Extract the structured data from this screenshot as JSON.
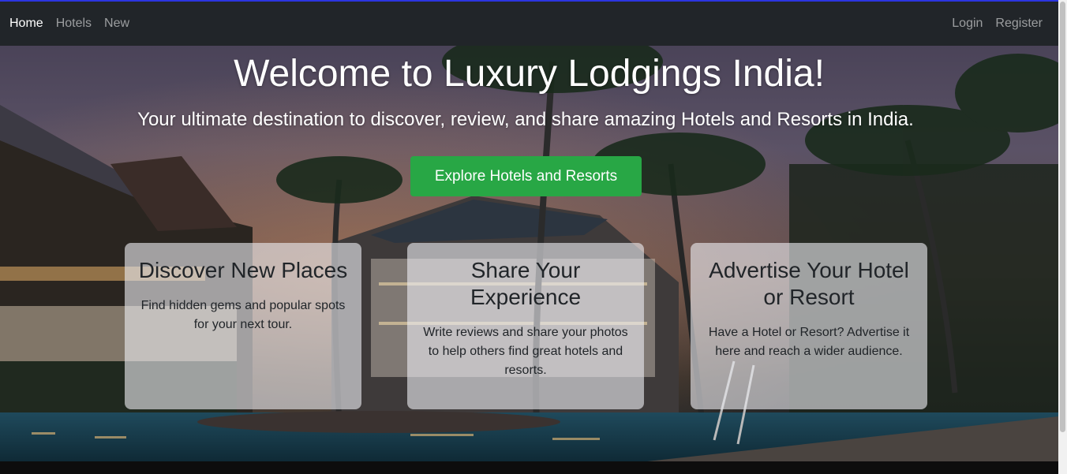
{
  "nav": {
    "left": [
      "Home",
      "Hotels",
      "New"
    ],
    "right": [
      "Login",
      "Register"
    ],
    "active": "Home"
  },
  "hero": {
    "title": "Welcome to Luxury Lodgings India!",
    "subtitle": "Your ultimate destination to discover, review, and share amazing Hotels and Resorts in India.",
    "cta_label": "Explore Hotels and Resorts"
  },
  "cards": [
    {
      "title": "Discover New Places",
      "text": "Find hidden gems and popular spots for your next tour."
    },
    {
      "title": "Share Your Experience",
      "text": "Write reviews and share your photos to help others find great hotels and resorts."
    },
    {
      "title": "Advertise Your Hotel or Resort",
      "text": "Have a Hotel or Resort? Advertise it here and reach a wider audience."
    }
  ],
  "colors": {
    "navbar": "#212529",
    "accent_top_line": "#2b35e0",
    "cta": "#28a745"
  }
}
